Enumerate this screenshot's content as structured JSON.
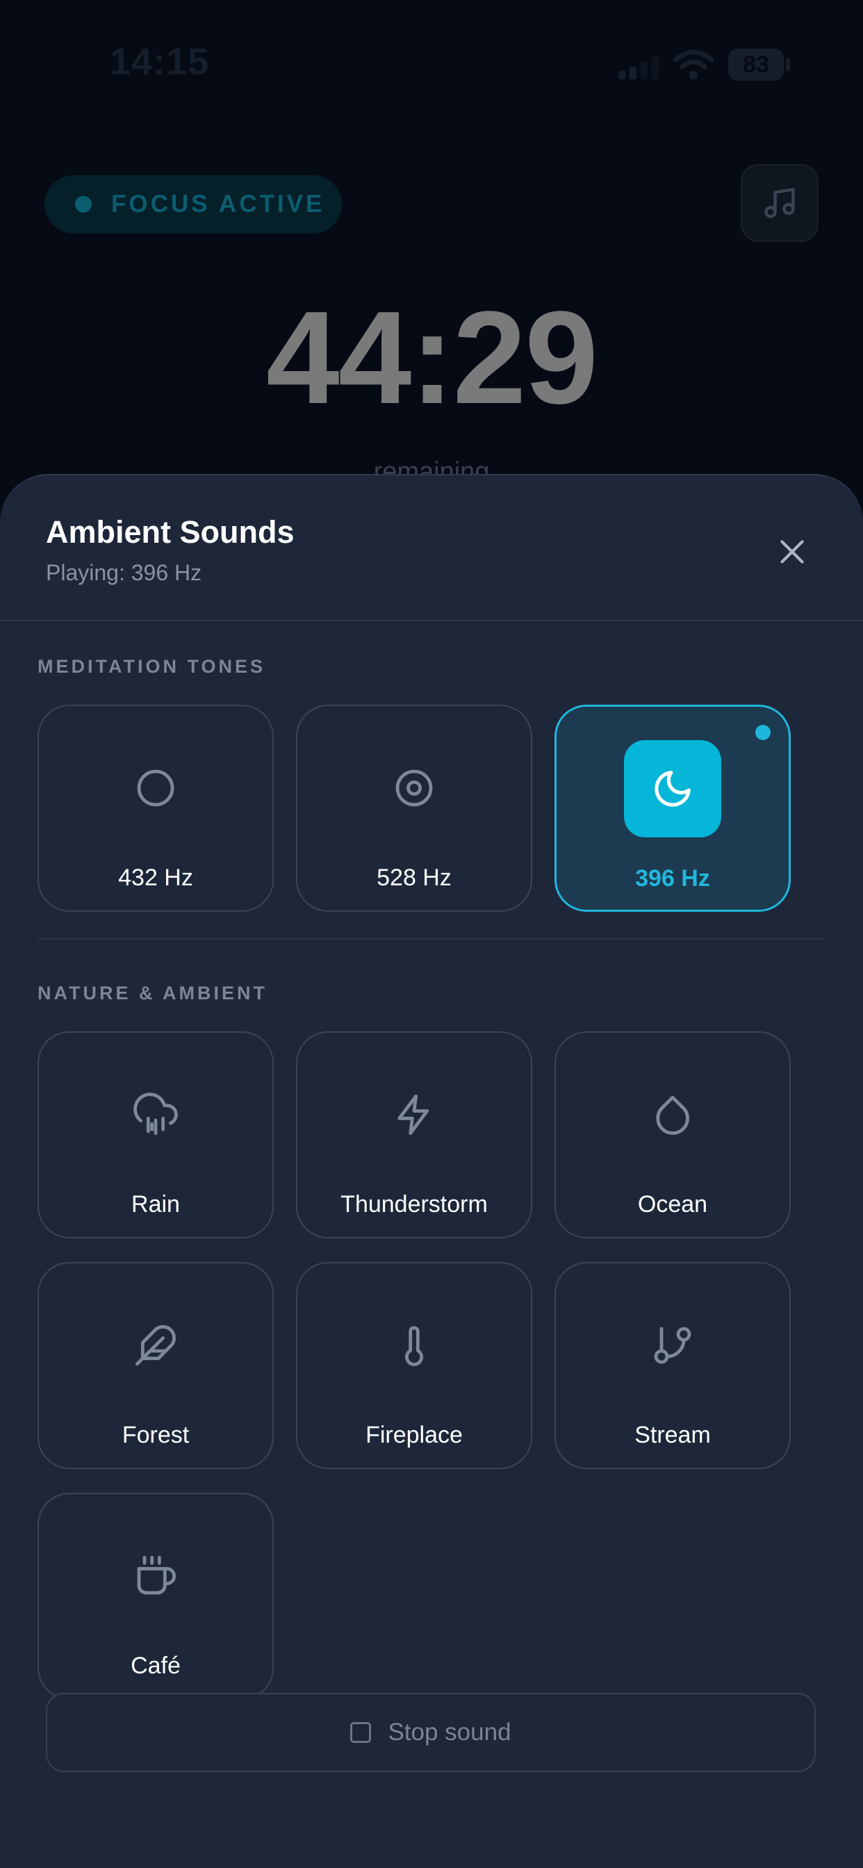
{
  "status_bar": {
    "time": "14:15",
    "battery": "83"
  },
  "focus": {
    "badge": "FOCUS ACTIVE",
    "timer": "44:29",
    "remaining": "remaining"
  },
  "sheet": {
    "title": "Ambient Sounds",
    "subtitle": "Playing: 396 Hz",
    "meditation_label": "MEDITATION TONES",
    "nature_label": "NATURE & AMBIENT",
    "meditation_tones": [
      {
        "label": "432 Hz",
        "icon": "circle-icon",
        "active": false
      },
      {
        "label": "528 Hz",
        "icon": "target-icon",
        "active": false
      },
      {
        "label": "396 Hz",
        "icon": "moon-icon",
        "active": true
      }
    ],
    "nature_sounds": [
      {
        "label": "Rain",
        "icon": "rain-cloud-icon"
      },
      {
        "label": "Thunderstorm",
        "icon": "lightning-icon"
      },
      {
        "label": "Ocean",
        "icon": "droplet-icon"
      },
      {
        "label": "Forest",
        "icon": "feather-icon"
      },
      {
        "label": "Fireplace",
        "icon": "thermometer-icon"
      },
      {
        "label": "Stream",
        "icon": "git-branch-icon"
      },
      {
        "label": "Café",
        "icon": "coffee-cup-icon"
      }
    ],
    "stop_label": "Stop sound"
  },
  "colors": {
    "accent": "#06b6d8",
    "sheet_bg": "#1e2739",
    "page_bg": "#050a14",
    "icon_stroke": "#7d889b"
  }
}
